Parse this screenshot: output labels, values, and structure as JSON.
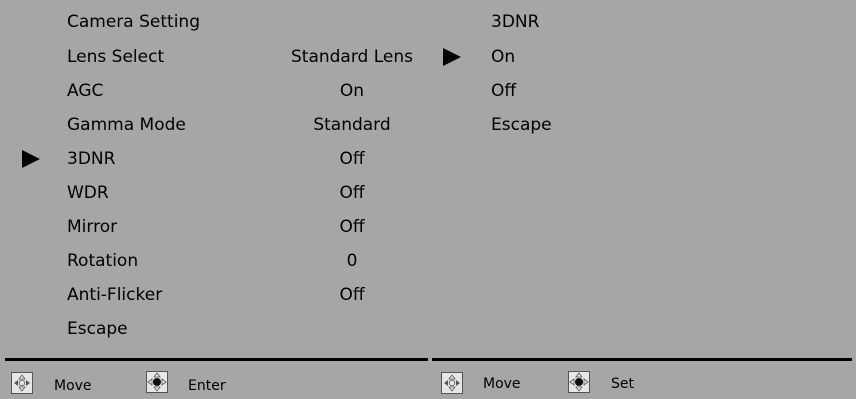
{
  "camera_menu": {
    "title": "Camera Setting",
    "items": [
      {
        "label": "Lens Select",
        "value": "Standard Lens"
      },
      {
        "label": "AGC",
        "value": "On"
      },
      {
        "label": "Gamma Mode",
        "value": "Standard"
      },
      {
        "label": "3DNR",
        "value": "Off",
        "selected": true
      },
      {
        "label": "WDR",
        "value": "Off"
      },
      {
        "label": "Mirror",
        "value": "Off"
      },
      {
        "label": "Rotation",
        "value": "0"
      },
      {
        "label": "Anti-Flicker",
        "value": "Off"
      },
      {
        "label": "Escape",
        "value": ""
      }
    ],
    "footer": {
      "move_label": "Move",
      "enter_label": "Enter"
    }
  },
  "submenu": {
    "title": "3DNR",
    "options": [
      {
        "label": "On",
        "selected": true
      },
      {
        "label": "Off"
      },
      {
        "label": "Escape"
      }
    ],
    "footer": {
      "move_label": "Move",
      "set_label": "Set"
    }
  },
  "icons": {
    "cursor": "triangle-right-icon",
    "move_hint": "dpad-left-right-icon",
    "select_hint": "dpad-center-icon"
  },
  "colors": {
    "panel_bg": "#a6a6a6",
    "text": "#000000",
    "rule": "#000000"
  }
}
